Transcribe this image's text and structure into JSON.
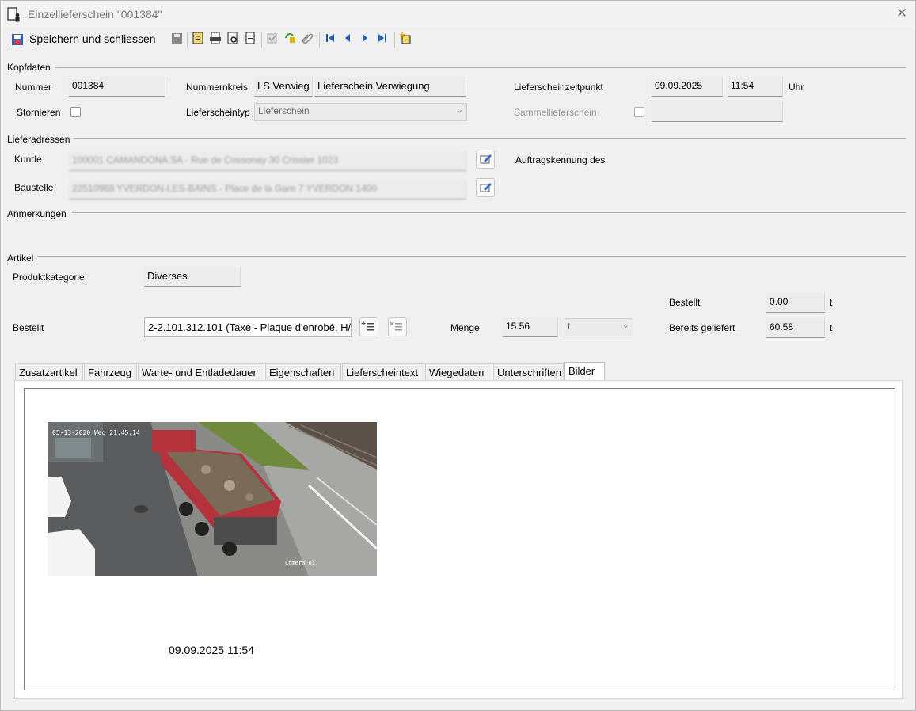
{
  "window": {
    "title": "Einzellieferschein \"001384\""
  },
  "toolbar": {
    "save_close_label": "Speichern und schliessen",
    "icons": [
      "save-disk-icon",
      "report-icon",
      "print-preview-icon",
      "search-doc-icon",
      "document-icon",
      "check-icon",
      "undo-lock-icon",
      "paperclip-icon",
      "first-record-icon",
      "previous-record-icon",
      "next-record-icon",
      "last-record-icon",
      "new-star-icon"
    ]
  },
  "kopfdaten": {
    "group_label": "Kopfdaten",
    "nummer_label": "Nummer",
    "nummer_value": "001384",
    "nummernkreis_label": "Nummernkreis",
    "nummernkreis_code": "LS Verwieg",
    "nummernkreis_name": "Lieferschein Verwiegung",
    "zeitpunkt_label": "Lieferscheinzeitpunkt",
    "zeitpunkt_date": "09.09.2025",
    "zeitpunkt_time": "11:54",
    "uhr_label": "Uhr",
    "stornieren_label": "Stornieren",
    "typ_label": "Lieferscheintyp",
    "typ_value": "Lieferschein",
    "sammel_label": "Sammellieferschein"
  },
  "lieferadressen": {
    "group_label": "Lieferadressen",
    "kunde_label": "Kunde",
    "kunde_value": "100001 CAMANDONA SA - Rue de Cossonay 30 Crissier 1023",
    "baustelle_label": "Baustelle",
    "baustelle_value": "22510968 YVERDON-LES-BAINS - Place de la Gare 7 YVERDON 1400",
    "auftrag_label": "Auftragskennung des"
  },
  "anmerkungen": {
    "group_label": "Anmerkungen"
  },
  "artikel": {
    "group_label": "Artikel",
    "produktkategorie_label": "Produktkategorie",
    "produktkategorie_value": "Diverses",
    "bestellt_label": "Bestellt",
    "bestellt_value": "2-2.101.312.101 (Taxe - Plaque d'enrobé, H/",
    "menge_label": "Menge",
    "menge_value": "15.56",
    "menge_unit": "t",
    "bestellt_qty_label": "Bestellt",
    "bestellt_qty_value": "0.00",
    "bestellt_qty_unit": "t",
    "geliefert_label": "Bereits geliefert",
    "geliefert_value": "60.58",
    "geliefert_unit": "t"
  },
  "tabs": [
    "Zusatzartikel",
    "Fahrzeug",
    "Warte- und Entladedauer",
    "Eigenschaften",
    "Lieferscheintext",
    "Wiegedaten",
    "Unterschriften",
    "Bilder"
  ],
  "active_tab": "Bilder",
  "bilder": {
    "camera_overlay": "05-13-2020 Wed 21:45:14",
    "camera_label": "Camera 01",
    "caption": "09.09.2025 11:54"
  }
}
